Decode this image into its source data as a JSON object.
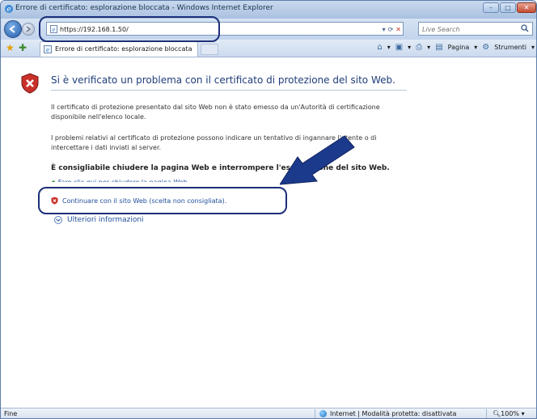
{
  "window": {
    "title": "Errore di certificato: esplorazione bloccata - Windows Internet Explorer",
    "controls": {
      "minimize": "–",
      "maximize": "□",
      "close": "✕"
    }
  },
  "address_bar": {
    "url": "https://192.168.1.50/"
  },
  "search": {
    "placeholder": "Live Search"
  },
  "tab": {
    "label": "Errore di certificato: esplorazione bloccata"
  },
  "command_bar": {
    "page": "Pagina",
    "tools": "Strumenti"
  },
  "page": {
    "title": "Si è verificato un problema con il certificato di protezione del sito Web.",
    "paragraph1": "Il certificato di protezione presentato dal sito Web non è stato emesso da un'Autorità di certificazione disponibile nell'elenco locale.",
    "paragraph2": "I problemi relativi al certificato di protezione possono indicare un tentativo di ingannare l'utente o di intercettare i dati inviati al server.",
    "recommendation": "È consigliabile chiudere la pagina Web e interrompere l'esplorazione del sito Web.",
    "close_link": "Fare clic qui per chiudere la pagina Web.",
    "continue_link": "Continuare con il sito Web (scelta non consigliata).",
    "more_info": "Ulteriori informazioni"
  },
  "status_bar": {
    "left": "Fine",
    "zone": "Internet | Modalità protetta: disattivata",
    "zoom": "100%"
  }
}
